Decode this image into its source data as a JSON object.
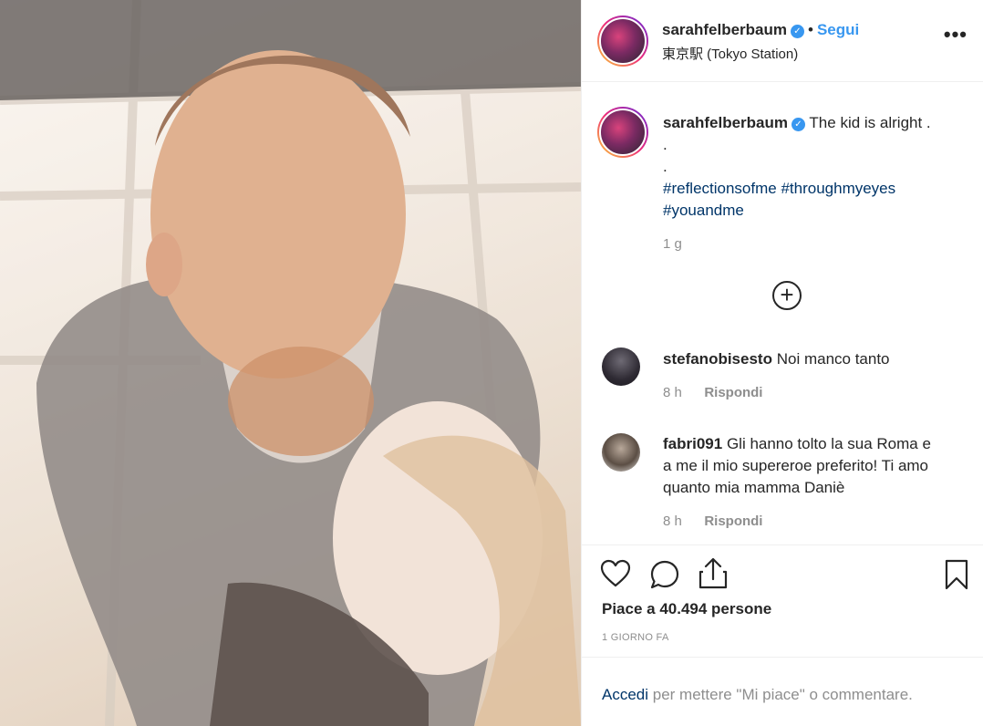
{
  "post": {
    "username": "sarahfelberbaum",
    "follow_label": "Segui",
    "dot": "•",
    "location": "東京駅 (Tokyo Station)",
    "more_label": "•••"
  },
  "caption": {
    "username": "sarahfelberbaum",
    "text": "The kid is alright .",
    "line2": ".",
    "line3": ".",
    "hashtags_line1": "#reflectionsofme #throughmyeyes",
    "hashtags_line2": "#youandme",
    "time": "1 g"
  },
  "load_more_label": "+",
  "comments": [
    {
      "username": "stefanobisesto",
      "text": "Noi manco tanto",
      "time": "8 h",
      "reply": "Rispondi"
    },
    {
      "username": "fabri091",
      "text_line1": "Gli hanno tolto la sua Roma e",
      "text_line2": "a me il mio supereroe preferito! Ti amo",
      "text_line3": "quanto mia mamma Daniè",
      "time": "8 h",
      "reply": "Rispondi"
    }
  ],
  "actions": {
    "like_icon": "heart-icon",
    "comment_icon": "comment-icon",
    "share_icon": "share-icon",
    "save_icon": "bookmark-icon"
  },
  "likes": "Piace a 40.494 persone",
  "date": "1 GIORNO FA",
  "login": {
    "link": "Accedi",
    "rest": "per mettere \"Mi piace\" o commentare."
  },
  "colors": {
    "accent": "#3897f0",
    "link": "#003569",
    "muted": "#8e8e8e"
  }
}
